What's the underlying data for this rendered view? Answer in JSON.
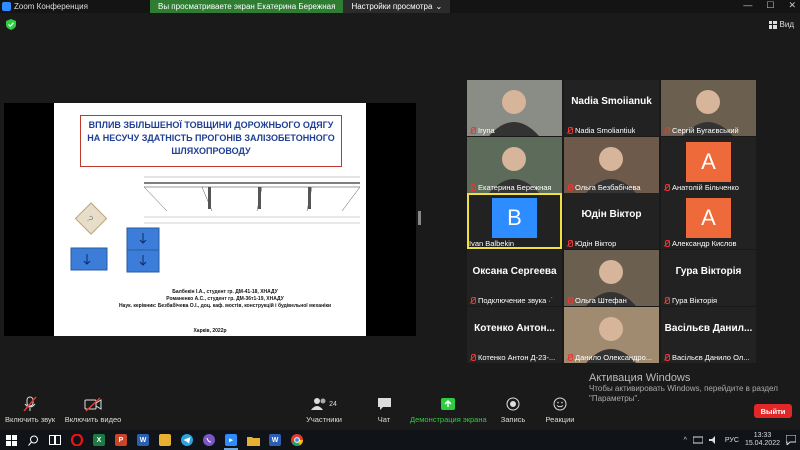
{
  "window": {
    "title": "Zoom Конференция",
    "minimize": "—",
    "maximize": "☐",
    "close": "✕"
  },
  "share_banner": {
    "message": "Вы просматриваете экран Екатерина Бережная",
    "options_label": "Настройки просмотра",
    "options_chevron": "⌄"
  },
  "view_button": {
    "label": "Вид",
    "icon": "grid-icon"
  },
  "slide": {
    "title": "ВПЛИВ ЗБІЛЬШЕНОЇ ТОВЩИНИ ДОРОЖНЬОГО ОДЯГУ НА НЕСУЧУ ЗДАТНІСТЬ ПРОГОНІВ ЗАЛІЗОБЕТОННОГО ШЛЯХОПРОВОДУ",
    "authors": [
      "Балбекін І.А., студент гр. ДМ-41-18, ХНАДУ",
      "Романенко А.С., студент гр. ДМ-36т1-19, ХНАДУ",
      "Наук. керівник: Безбабічева О.І., доц. каф. мостів, конструкцій і будівельної механіки"
    ],
    "city": "Харків, 2022р"
  },
  "participants": [
    {
      "display": "Iryna",
      "big": "",
      "avatar": "",
      "type": "video"
    },
    {
      "display": "Nadia Smoliantiuk",
      "big": "Nadia Smoiianuk",
      "avatar": "",
      "type": "name"
    },
    {
      "display": "Сергій Бугаєвський",
      "big": "",
      "avatar": "",
      "type": "video"
    },
    {
      "display": "Екатерина Бережная",
      "big": "",
      "avatar": "",
      "type": "video"
    },
    {
      "display": "Ольга Безбабічева",
      "big": "",
      "avatar": "",
      "type": "video"
    },
    {
      "display": "Анатолій Більченко",
      "big": "",
      "avatar": "A",
      "type": "avatar",
      "color": "#ee6a3a"
    },
    {
      "display": "Ivan Balbekin",
      "big": "",
      "avatar": "B",
      "type": "avatar",
      "color": "#2d8cff"
    },
    {
      "display": "Юдін Віктор",
      "big": "Юдін Віктор",
      "avatar": "",
      "type": "name"
    },
    {
      "display": "Александр Кислов",
      "big": "",
      "avatar": "A",
      "type": "avatar",
      "color": "#ee6a3a"
    },
    {
      "display": "Подключение звука ·˙",
      "big": "Оксана Сергеева",
      "avatar": "",
      "type": "name"
    },
    {
      "display": "Ольга Штефан",
      "big": "",
      "avatar": "",
      "type": "video"
    },
    {
      "display": "Гура Вікторія",
      "big": "Гура Вікторія",
      "avatar": "",
      "type": "name"
    },
    {
      "display": "Котенко Антон Д-23-...",
      "big": "Котенко Антон...",
      "avatar": "",
      "type": "name"
    },
    {
      "display": "Данило Олександро...",
      "big": "",
      "avatar": "",
      "type": "video"
    },
    {
      "display": "Васільєв Данило Ол...",
      "big": "Васільєв Данил...",
      "avatar": "",
      "type": "name"
    }
  ],
  "toolbar": {
    "unmute": "Включить звук",
    "video": "Включить видео",
    "participants": "Участники",
    "participants_count": "24",
    "chat": "Чат",
    "share": "Демонстрация экрана",
    "record": "Запись",
    "reactions": "Реакции",
    "leave": "Выйти",
    "share_color": "#2ecc40"
  },
  "activation": {
    "title": "Активация Windows",
    "body": "Чтобы активировать Windows, перейдите в раздел \"Параметры\"."
  },
  "taskbar": {
    "apps": [
      "windows-start",
      "search",
      "task-view",
      "opera",
      "excel",
      "powerpoint",
      "word-blue",
      "files",
      "telegram",
      "viber",
      "zoom",
      "folder",
      "word",
      "chrome"
    ],
    "lang": "РУС",
    "time": "13:33",
    "date": "15.04.2022"
  }
}
